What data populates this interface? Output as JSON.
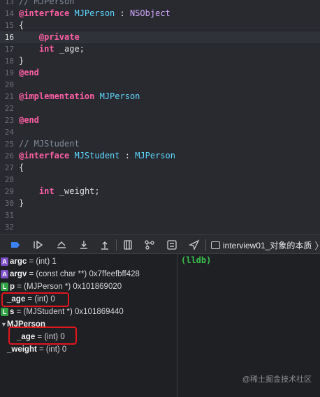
{
  "editor": {
    "current_line": "16",
    "lines": [
      {
        "num": "13",
        "tokens": [
          {
            "t": "// MJPerson",
            "c": "cmt"
          }
        ]
      },
      {
        "num": "14",
        "tokens": [
          {
            "t": "@interface",
            "c": "kw"
          },
          {
            "t": " "
          },
          {
            "t": "MJPerson",
            "c": "cls"
          },
          {
            "t": " : "
          },
          {
            "t": "NSObject",
            "c": "typ"
          }
        ]
      },
      {
        "num": "15",
        "tokens": [
          {
            "t": "{"
          }
        ]
      },
      {
        "num": "16",
        "tokens": [
          {
            "t": "    "
          },
          {
            "t": "@private",
            "c": "kw"
          }
        ]
      },
      {
        "num": "17",
        "tokens": [
          {
            "t": "    "
          },
          {
            "t": "int",
            "c": "kw"
          },
          {
            "t": " _age;"
          }
        ]
      },
      {
        "num": "18",
        "tokens": [
          {
            "t": "}"
          }
        ]
      },
      {
        "num": "19",
        "tokens": [
          {
            "t": "@end",
            "c": "kw"
          }
        ]
      },
      {
        "num": "20",
        "tokens": []
      },
      {
        "num": "21",
        "tokens": [
          {
            "t": "@implementation",
            "c": "kw"
          },
          {
            "t": " "
          },
          {
            "t": "MJPerson",
            "c": "cls"
          }
        ]
      },
      {
        "num": "22",
        "tokens": []
      },
      {
        "num": "23",
        "tokens": [
          {
            "t": "@end",
            "c": "kw"
          }
        ]
      },
      {
        "num": "24",
        "tokens": []
      },
      {
        "num": "25",
        "tokens": [
          {
            "t": "// MJStudent",
            "c": "cmt"
          }
        ]
      },
      {
        "num": "26",
        "tokens": [
          {
            "t": "@interface",
            "c": "kw"
          },
          {
            "t": " "
          },
          {
            "t": "MJStudent",
            "c": "cls"
          },
          {
            "t": " : "
          },
          {
            "t": "MJPerson",
            "c": "cls"
          }
        ]
      },
      {
        "num": "27",
        "tokens": [
          {
            "t": "{"
          }
        ]
      },
      {
        "num": "28",
        "tokens": []
      },
      {
        "num": "29",
        "tokens": [
          {
            "t": "    "
          },
          {
            "t": "int",
            "c": "kw"
          },
          {
            "t": " _weight;"
          }
        ]
      },
      {
        "num": "30",
        "tokens": [
          {
            "t": "}"
          }
        ]
      },
      {
        "num": "31",
        "tokens": []
      },
      {
        "num": "32",
        "tokens": []
      }
    ]
  },
  "toolbar": {
    "breadcrumb_label": "interview01_对象的本质",
    "icons": [
      "breakpoint-toggle-icon",
      "continue-icon",
      "step-over-icon",
      "step-into-icon",
      "step-out-icon",
      "view-hierarchy-icon",
      "memory-graph-icon",
      "environment-overrides-icon",
      "location-icon",
      "file-icon"
    ]
  },
  "variables": [
    {
      "badge": "A",
      "name": "argc",
      "rest": " = (int) 1"
    },
    {
      "badge": "A",
      "name": "argv",
      "rest": " = (const char **) 0x7ffeefbff428"
    },
    {
      "badge": "L",
      "name": "p",
      "rest": " = (MJPerson *) 0x101869020"
    },
    {
      "badge": "",
      "name": "_age",
      "rest": " = (int) 0"
    },
    {
      "badge": "L",
      "name": "s",
      "rest": " = (MJStudent *) 0x101869440"
    },
    {
      "badge": "",
      "name": "MJPerson",
      "rest": "",
      "disclosure": "▼"
    },
    {
      "badge": "",
      "name": "_age",
      "rest": " = (int) 0"
    },
    {
      "badge": "",
      "name": "_weight",
      "rest": " = (int) 0"
    }
  ],
  "console": {
    "prompt": "(lldb)",
    "watermark": "@稀土掘金技术社区"
  },
  "colors": {
    "highlight_box": "#e0161f",
    "keyword": "#fc5fa3",
    "class_name": "#5dd8ff",
    "lldb_prompt": "#39c34e"
  }
}
